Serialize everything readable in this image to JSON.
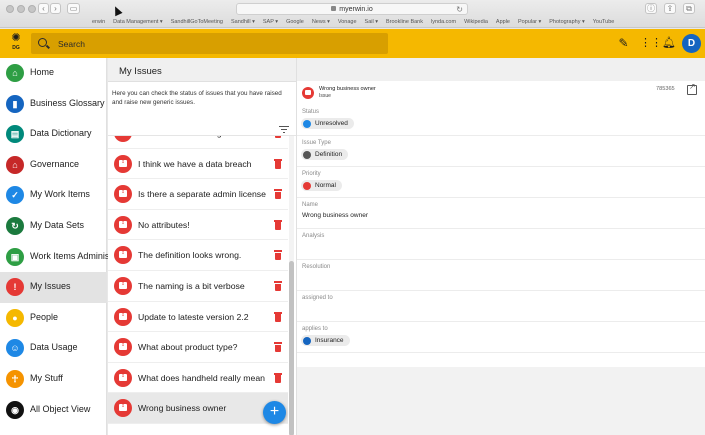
{
  "browser": {
    "url": "myerwin.io",
    "bookmarks": [
      "erwin",
      "Data Management ▾",
      "SandhillGoToMeeting",
      "Sandhill ▾",
      "SAP ▾",
      "Google",
      "News ▾",
      "Vonage",
      "Sail ▾",
      "Brookline Bank",
      "lynda.com",
      "Wikipedia",
      "Apple",
      "Popular ▾",
      "Photography ▾",
      "YouTube"
    ]
  },
  "header": {
    "logo_text": "DG",
    "search_placeholder": "Search",
    "avatar_letter": "D",
    "accent_color": "#f5b800"
  },
  "sidebar": {
    "items": [
      {
        "label": "Home",
        "icon": "home-icon",
        "color": "#2e9e44",
        "glyph": "⌂"
      },
      {
        "label": "Business Glossary",
        "icon": "book-icon",
        "color": "#1565c0",
        "glyph": "▮"
      },
      {
        "label": "Data Dictionary",
        "icon": "dictionary-icon",
        "color": "#00897b",
        "glyph": "▤"
      },
      {
        "label": "Governance",
        "icon": "bank-icon",
        "color": "#c62828",
        "glyph": "⌂"
      },
      {
        "label": "My Work Items",
        "icon": "checkbox-icon",
        "color": "#1e88e5",
        "glyph": "✓"
      },
      {
        "label": "My Data Sets",
        "icon": "sync-icon",
        "color": "#1b7a3e",
        "glyph": "↻"
      },
      {
        "label": "Work Items Adminis",
        "icon": "assignment-icon",
        "color": "#2e9e44",
        "glyph": "▣"
      },
      {
        "label": "My Issues",
        "icon": "feedback-icon",
        "color": "#e53935",
        "glyph": "!"
      },
      {
        "label": "People",
        "icon": "person-icon",
        "color": "#f5b800",
        "glyph": "●"
      },
      {
        "label": "Data Usage",
        "icon": "accessibility-icon",
        "color": "#1e88e5",
        "glyph": "☺"
      },
      {
        "label": "My Stuff",
        "icon": "figure-icon",
        "color": "#f59300",
        "glyph": "☥"
      },
      {
        "label": "All Object View",
        "icon": "globe-icon",
        "color": "#111111",
        "glyph": "◉"
      }
    ],
    "active_index": 7
  },
  "issues": {
    "title": "My Issues",
    "intro": "Here you can check the status of issues that you have raised and raise new generic issues.",
    "items": [
      "I think we are missing the value f",
      "I think we have a data breach",
      "Is there a separate admin license",
      "No attributes!",
      "The definition looks wrong.",
      "The naming is a bit verbose",
      "Update to lateste version 2.2",
      "What about product type?",
      "What does handheld really mean",
      "Wrong business owner"
    ],
    "selected_index": 9,
    "add_label": "+"
  },
  "detail": {
    "title": "Wrong business owner",
    "type": "Issue",
    "id": "785365",
    "fields": [
      {
        "label": "Status",
        "value": "Unresolved",
        "chip": true,
        "chip_color": "#1e88e5"
      },
      {
        "label": "Issue Type",
        "value": "Definition",
        "chip": true,
        "chip_color": "#555555"
      },
      {
        "label": "Priority",
        "value": "Normal",
        "chip": true,
        "chip_color": "#e53935"
      },
      {
        "label": "Name",
        "value": "Wrong business owner",
        "chip": false
      },
      {
        "label": "Analysis",
        "value": "",
        "chip": false
      },
      {
        "label": "Resolution",
        "value": "",
        "chip": false
      },
      {
        "label": "assigned to",
        "value": "",
        "chip": false
      },
      {
        "label": "applies to",
        "value": "Insurance",
        "chip": true,
        "chip_color": "#1565c0"
      }
    ]
  }
}
